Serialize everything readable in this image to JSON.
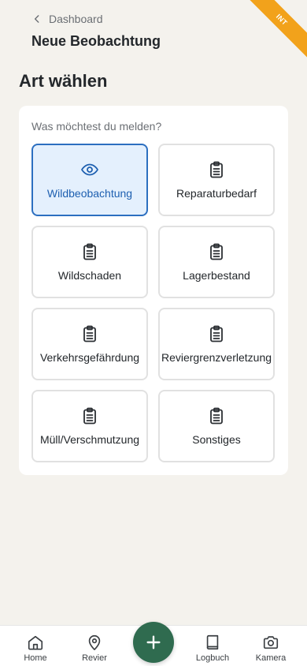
{
  "header": {
    "back_label": "Dashboard",
    "title": "Neue Beobachtung",
    "env_badge": "INT"
  },
  "section": {
    "title": "Art wählen",
    "question": "Was möchtest du melden?"
  },
  "options": [
    {
      "label": "Wildbeobachtung",
      "icon": "eye-icon",
      "selected": true
    },
    {
      "label": "Reparaturbedarf",
      "icon": "clipboard-icon",
      "selected": false
    },
    {
      "label": "Wildschaden",
      "icon": "clipboard-icon",
      "selected": false
    },
    {
      "label": "Lagerbestand",
      "icon": "clipboard-icon",
      "selected": false
    },
    {
      "label": "Verkehrsgefährdung",
      "icon": "clipboard-icon",
      "selected": false
    },
    {
      "label": "Reviergrenzverletzung",
      "icon": "clipboard-icon",
      "selected": false
    },
    {
      "label": "Müll/Verschmutzung",
      "icon": "clipboard-icon",
      "selected": false
    },
    {
      "label": "Sonstiges",
      "icon": "clipboard-icon",
      "selected": false
    }
  ],
  "nav": {
    "home": "Home",
    "revier": "Revier",
    "logbuch": "Logbuch",
    "kamera": "Kamera"
  },
  "colors": {
    "accent": "#2c6fc0",
    "fab": "#2f6b4f",
    "badge": "#f2a21b"
  }
}
